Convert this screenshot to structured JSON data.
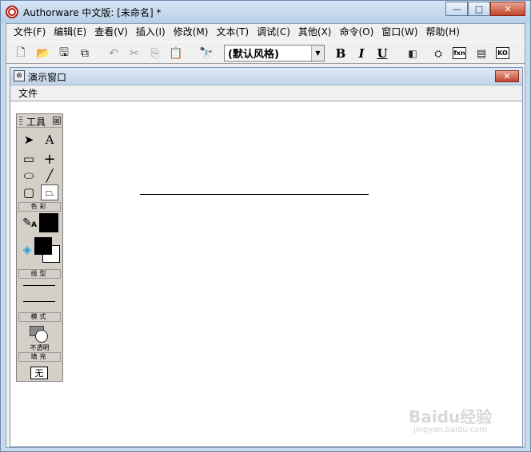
{
  "window": {
    "title": "Authorware 中文版: [未命名] *",
    "min_glyph": "—",
    "max_glyph": "□",
    "close_glyph": "✕"
  },
  "menu": [
    "文件(F)",
    "编辑(E)",
    "查看(V)",
    "插入(I)",
    "修改(M)",
    "文本(T)",
    "调试(C)",
    "其他(X)",
    "命令(O)",
    "窗口(W)",
    "帮助(H)"
  ],
  "toolbar": {
    "style_value": "(默认风格)",
    "bold": "B",
    "italic": "I",
    "underline": "U",
    "fn_label": "fxn",
    "ko_label": "KO"
  },
  "presentation": {
    "title": "演示窗口",
    "close_glyph": "✕",
    "menu_file": "文件"
  },
  "tools": {
    "title": "工具",
    "close_glyph": "⊠",
    "text_tool": "A",
    "color_label": "色彩",
    "line_label": "线型",
    "mode_label": "模式",
    "mode_value": "不透明",
    "fill_label": "填充",
    "fill_value": "无",
    "pen_letter": "A"
  },
  "watermark": {
    "brand": "Baidu经验",
    "url": "jingyan.baidu.com"
  },
  "colors": {
    "foreground": "#000000",
    "background": "#ffffff"
  }
}
